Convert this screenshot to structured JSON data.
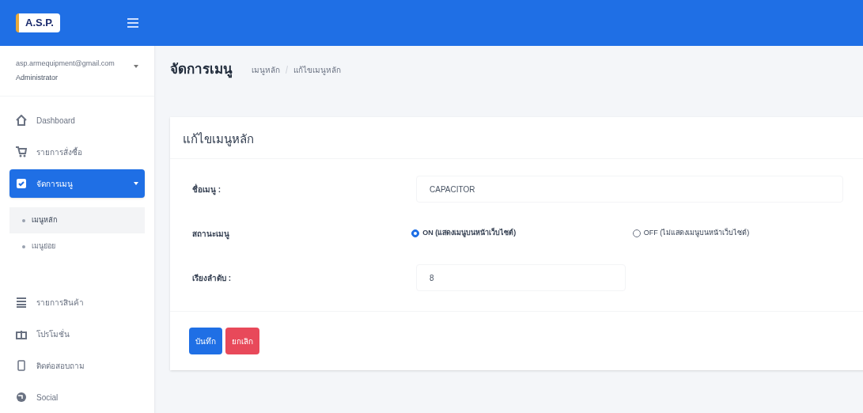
{
  "logo": {
    "text": "A.S.P."
  },
  "user": {
    "email": "asp.armequipment@gmail.com",
    "role": "Administrator"
  },
  "sidebar": {
    "items": [
      {
        "kind": "item",
        "label": "Dashboard",
        "selected": false
      },
      {
        "kind": "item",
        "label": "รายการสั่งซื้อ",
        "selected": false
      },
      {
        "kind": "group",
        "label": "จัดการเมนู",
        "selected": true,
        "expanded": true,
        "children": [
          {
            "label": "เมนูหลัก",
            "selected": true
          },
          {
            "label": "เมนูย่อย",
            "selected": false
          }
        ]
      },
      {
        "kind": "item",
        "label": "รายการสินค้า",
        "selected": false
      },
      {
        "kind": "item",
        "label": "โปรโมชั่น",
        "selected": false
      },
      {
        "kind": "item",
        "label": "ติดต่อสอบถาม",
        "selected": false
      },
      {
        "kind": "item",
        "label": "Social",
        "selected": false
      }
    ]
  },
  "header": {
    "title": "จัดการเมนู",
    "breadcrumb": [
      "เมนูหลัก",
      "แก้ไขเมนูหลัก"
    ]
  },
  "card": {
    "title": "แก้ไขเมนูหลัก",
    "fields": [
      {
        "kind": "text",
        "label": "ชื่อเมนู :",
        "value": "CAPACITOR"
      },
      {
        "kind": "radio",
        "label": "สถานะเมนู",
        "options": [
          {
            "label": "ON (แสดงเมนูบนหน้าเว็บไซต์)",
            "selected": true
          },
          {
            "label": "OFF (ไม่แสดงเมนูบนหน้าเว็บไซต์)",
            "selected": false
          }
        ]
      },
      {
        "kind": "number",
        "label": "เรียงลำดับ :",
        "value": "8"
      }
    ],
    "buttons": [
      {
        "kind": "primary",
        "label": "บันทึก"
      },
      {
        "kind": "danger",
        "label": "ยกเลิก"
      }
    ]
  }
}
